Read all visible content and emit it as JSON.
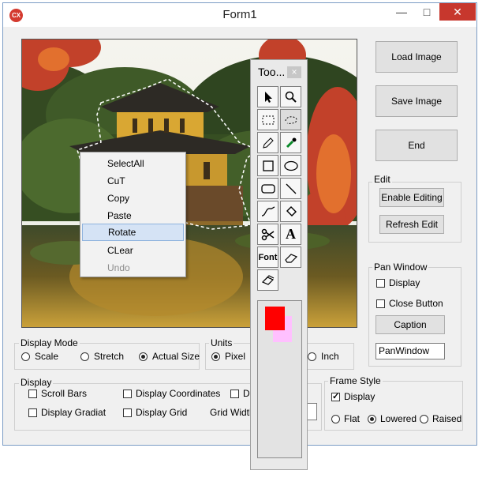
{
  "window": {
    "title": "Form1",
    "app_icon": "CX",
    "controls": [
      "minimize",
      "maximize",
      "close"
    ]
  },
  "buttons": {
    "load_image": "Load Image",
    "save_image": "Save Image",
    "end": "End"
  },
  "edit_group": {
    "title": "Edit",
    "enable_editing": "Enable Editing",
    "refresh_edit": "Refresh Edit"
  },
  "pan_window": {
    "title": "Pan Window",
    "display_label": "Display",
    "display_checked": false,
    "close_button_label": "Close Button",
    "close_button_checked": false,
    "caption_button": "Caption",
    "caption_value": "PanWindow"
  },
  "display_mode": {
    "title": "Display Mode",
    "options": [
      {
        "label": "Scale",
        "selected": false
      },
      {
        "label": "Stretch",
        "selected": false
      },
      {
        "label": "Actual Size",
        "selected": true
      }
    ]
  },
  "units": {
    "title": "Units",
    "options": [
      {
        "label": "Pixel",
        "selected": true
      },
      {
        "label": "Inch",
        "selected": false
      }
    ]
  },
  "display": {
    "title": "Display",
    "scroll_bars": "Scroll Bars",
    "display_coordinates": "Display Coordinates",
    "display_gradient": "Display Gradiat",
    "display_grid": "Display Grid",
    "grid_width": "Grid Width",
    "truncated_label": "Dr"
  },
  "frame_style": {
    "title": "Frame Style",
    "display_label": "Display",
    "display_checked": true,
    "options": [
      {
        "label": "Flat",
        "selected": false
      },
      {
        "label": "Lowered",
        "selected": true
      },
      {
        "label": "Raised",
        "selected": false
      }
    ]
  },
  "context_menu": {
    "items": [
      {
        "label": "SelectAll",
        "state": "normal"
      },
      {
        "label": "CuT",
        "state": "normal"
      },
      {
        "label": "Copy",
        "state": "normal"
      },
      {
        "label": "Paste",
        "state": "normal"
      },
      {
        "label": "Rotate",
        "state": "highlighted"
      },
      {
        "label": "CLear",
        "state": "normal"
      },
      {
        "label": "Undo",
        "state": "disabled"
      }
    ]
  },
  "toolbox": {
    "title": "Too...",
    "close_glyph": "×",
    "tools": [
      "pointer",
      "zoom",
      "rect-select",
      "lasso-select",
      "pencil",
      "eyedropper",
      "rectangle",
      "ellipse",
      "rounded-rectangle",
      "line",
      "curve",
      "fill-bucket",
      "scissors",
      "text",
      "font",
      "eraser",
      "stamp"
    ],
    "text_tool_label": "A",
    "font_tool_label": "Font",
    "primary_color": "#ff0000",
    "secondary_color": "#ffc0ff"
  }
}
